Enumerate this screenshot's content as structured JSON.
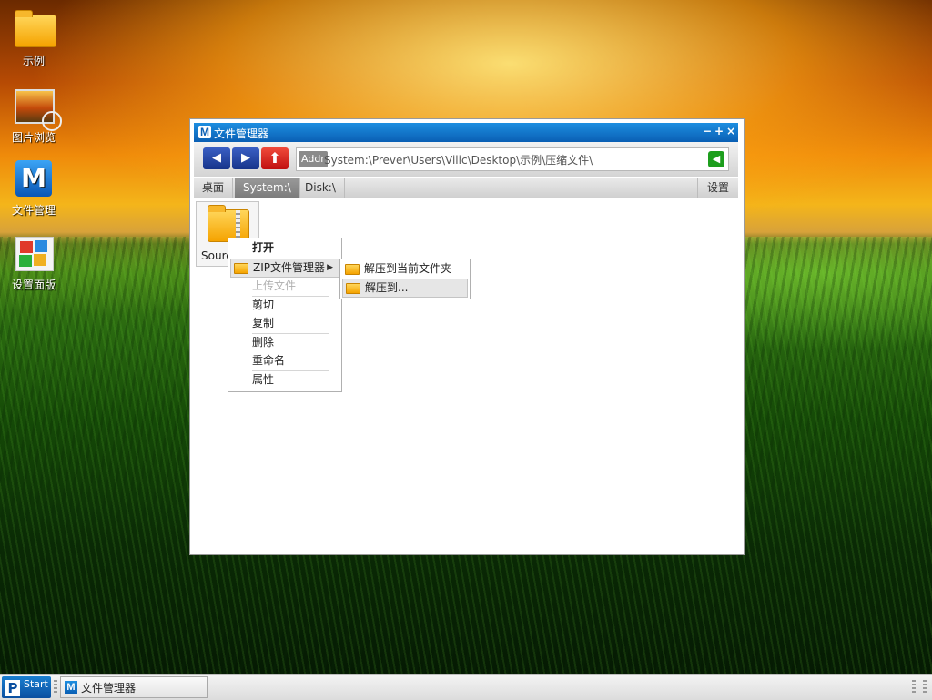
{
  "desktop": {
    "icons": [
      {
        "label": "示例",
        "icon": "folder-icon"
      },
      {
        "label": "图片浏览",
        "icon": "image-viewer-icon"
      },
      {
        "label": "文件管理",
        "icon": "file-manager-icon"
      },
      {
        "label": "设置面版",
        "icon": "control-panel-icon"
      }
    ]
  },
  "window": {
    "title": "文件管理器",
    "title_icon": "M",
    "controls": {
      "minimize": "−",
      "maximize": "+",
      "close": "×"
    },
    "address": {
      "label": "Addr",
      "path": "System:\\Prever\\Users\\Vilic\\Desktop\\示例\\压缩文件\\"
    },
    "tabs": [
      {
        "label": "桌面",
        "active": false
      },
      {
        "label": "System:\\",
        "active": true
      },
      {
        "label": "Disk:\\",
        "active": false
      }
    ],
    "settings_label": "设置",
    "files": [
      {
        "name": "Sourc",
        "icon": "zip-folder-icon"
      }
    ]
  },
  "context_menu": {
    "items": [
      {
        "label": "打开",
        "bold": true
      },
      {
        "label": "ZIP文件管理器",
        "submenu": true,
        "icon": "zip-icon"
      },
      {
        "label": "上传文件",
        "disabled": true
      },
      {
        "label": "剪切"
      },
      {
        "label": "复制"
      },
      {
        "label": "删除"
      },
      {
        "label": "重命名"
      },
      {
        "label": "属性"
      }
    ],
    "submenu": [
      {
        "label": "解压到当前文件夹",
        "icon": "zip-icon"
      },
      {
        "label": "解压到...",
        "icon": "zip-icon",
        "highlighted": true
      }
    ]
  },
  "taskbar": {
    "start_label": "Start",
    "start_letter": "P",
    "tasks": [
      {
        "label": "文件管理器",
        "icon_letter": "M"
      }
    ]
  },
  "colors": {
    "accent": "#0a5fb4",
    "title_bar": "#1d8ee0",
    "nav_up": "#e02a1a",
    "address_go": "#1d9e1d",
    "tab_active": "#8a8a8a"
  }
}
